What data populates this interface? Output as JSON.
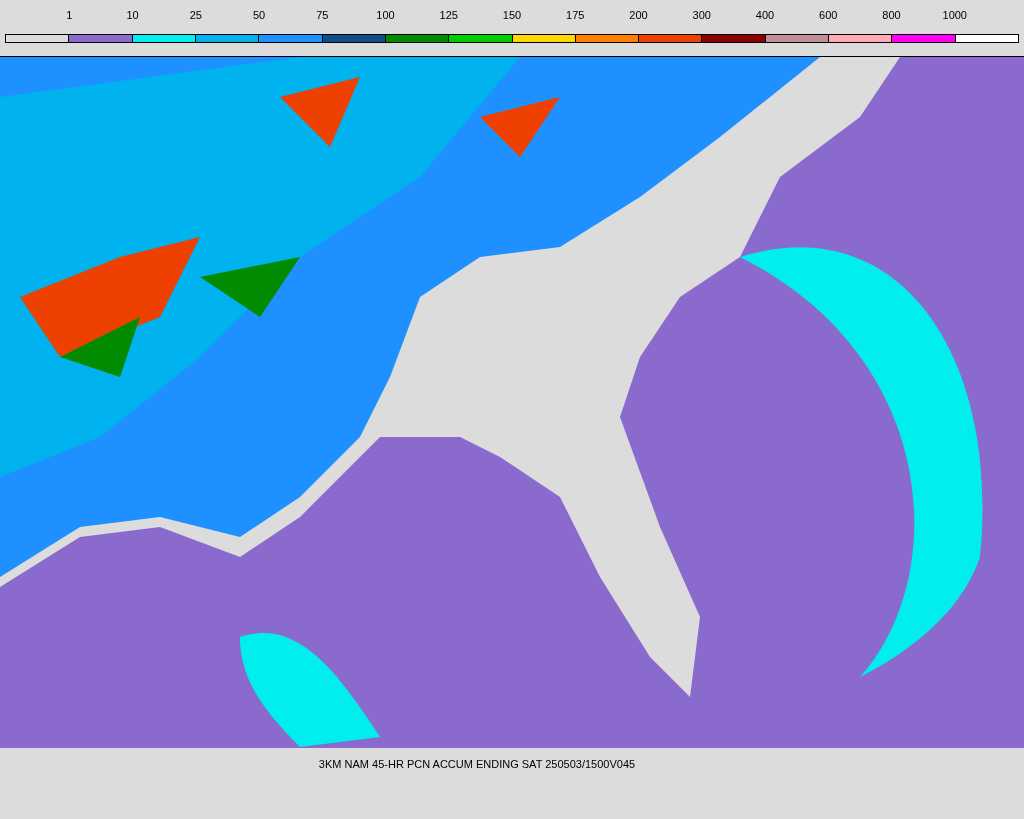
{
  "legend": [
    {
      "color": "#dcdcdc",
      "label": "1"
    },
    {
      "color": "#8a6acd",
      "label": "10"
    },
    {
      "color": "#00eeee",
      "label": "25"
    },
    {
      "color": "#00b2ee",
      "label": "50"
    },
    {
      "color": "#1e90ff",
      "label": "75"
    },
    {
      "color": "#104e8b",
      "label": "100"
    },
    {
      "color": "#008b00",
      "label": "125"
    },
    {
      "color": "#00cd00",
      "label": "150"
    },
    {
      "color": "#ffd700",
      "label": "175"
    },
    {
      "color": "#ff7f00",
      "label": "200"
    },
    {
      "color": "#ee4000",
      "label": "300"
    },
    {
      "color": "#8b0000",
      "label": "400"
    },
    {
      "color": "#c09098",
      "label": "600"
    },
    {
      "color": "#ffaab4",
      "label": "800"
    },
    {
      "color": "#ff00f0",
      "label": "1000"
    },
    {
      "color": "#ffffff"
    }
  ],
  "caption": "3KM NAM 45-HR PCN ACCUM ENDING SAT 250503/1500V045"
}
